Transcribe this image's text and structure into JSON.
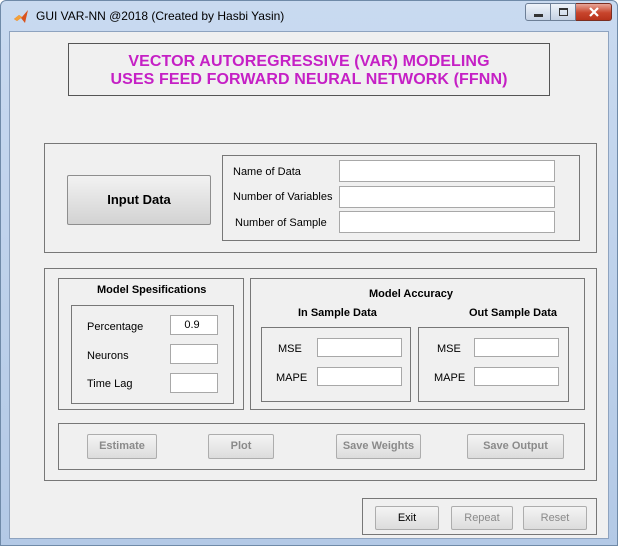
{
  "window": {
    "title": "GUI VAR-NN @2018 (Created by Hasbi Yasin)",
    "icon": "matlab-icon"
  },
  "heading": {
    "line1": "VECTOR AUTOREGRESSIVE (VAR) MODELING",
    "line2": "USES FEED FORWARD NEURAL NETWORK (FFNN)",
    "color": "#c520c5"
  },
  "input_panel": {
    "button_label": "Input Data",
    "fields": [
      {
        "label": "Name of Data",
        "value": ""
      },
      {
        "label": "Number of Variables",
        "value": ""
      },
      {
        "label": "Number of Sample",
        "value": ""
      }
    ]
  },
  "model_spec": {
    "title": "Model Spesifications",
    "fields": [
      {
        "label": "Percentage",
        "value": "0.9"
      },
      {
        "label": "Neurons",
        "value": ""
      },
      {
        "label": "Time Lag",
        "value": ""
      }
    ]
  },
  "model_accuracy": {
    "title": "Model Accuracy",
    "in_sample": {
      "title": "In Sample Data",
      "mse_label": "MSE",
      "mse_value": "",
      "mape_label": "MAPE",
      "mape_value": ""
    },
    "out_sample": {
      "title": "Out Sample Data",
      "mse_label": "MSE",
      "mse_value": "",
      "mape_label": "MAPE",
      "mape_value": ""
    }
  },
  "actions": {
    "estimate": "Estimate",
    "plot": "Plot",
    "save_weights": "Save Weights",
    "save_output": "Save Output"
  },
  "bottom": {
    "exit": "Exit",
    "repeat": "Repeat",
    "reset": "Reset"
  }
}
